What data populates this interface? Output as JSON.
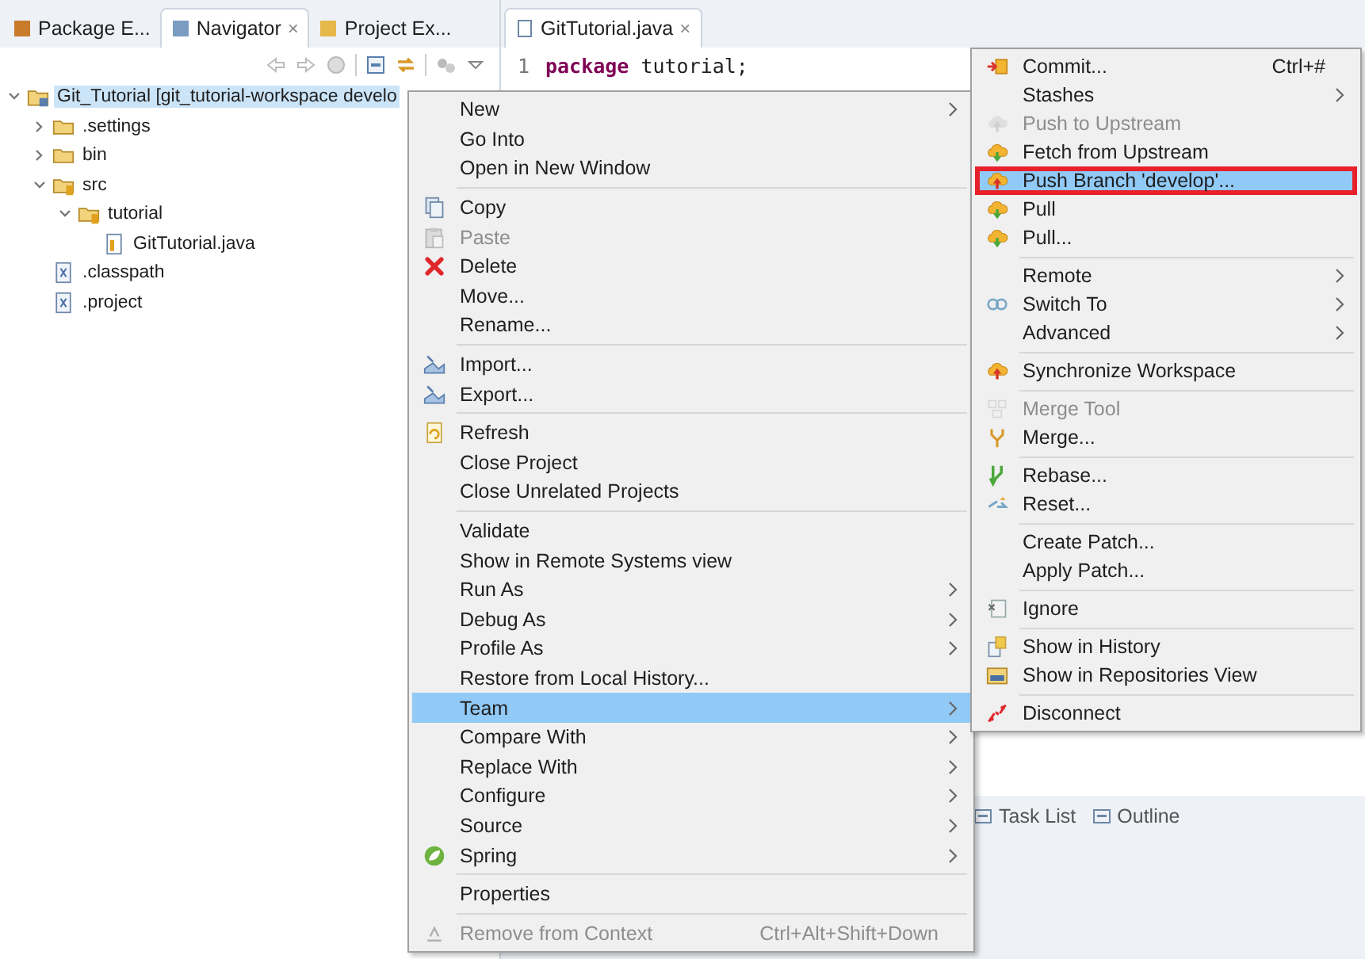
{
  "left_panel": {
    "tabs": [
      {
        "label": "Package E...",
        "selected": false
      },
      {
        "label": "Navigator",
        "selected": true,
        "close": "×"
      },
      {
        "label": "Project Ex...",
        "selected": false
      }
    ],
    "tree": [
      {
        "label": "Git_Tutorial [git_tutorial-workspace develo",
        "kind": "project",
        "selected": true,
        "expanded": true,
        "children": [
          {
            "label": ".settings",
            "kind": "folder",
            "selected": false,
            "expanded": false
          },
          {
            "label": "bin",
            "kind": "folder",
            "selected": false,
            "expanded": false
          },
          {
            "label": "src",
            "kind": "source",
            "selected": false,
            "expanded": true,
            "children": [
              {
                "label": "tutorial",
                "kind": "package",
                "selected": false,
                "expanded": true,
                "children": [
                  {
                    "label": "GitTutorial.java",
                    "kind": "java",
                    "selected": false
                  }
                ]
              }
            ]
          },
          {
            "label": ".classpath",
            "kind": "xml",
            "selected": false
          },
          {
            "label": ".project",
            "kind": "xml",
            "selected": false
          }
        ]
      }
    ]
  },
  "editor": {
    "tabs": [
      {
        "label": "GitTutorial.java",
        "selected": true,
        "close": "×"
      }
    ],
    "lines": [
      {
        "number": "1",
        "tokens": [
          {
            "text": "package",
            "kind": "keyword"
          },
          {
            "text": " tutorial;",
            "kind": "plain"
          }
        ]
      }
    ]
  },
  "bottom_panel": {
    "tabs": [
      {
        "label": "Task List"
      },
      {
        "label": "Outline"
      }
    ]
  },
  "context_menu": [
    {
      "kind": "item",
      "label": "New",
      "submenu": true
    },
    {
      "kind": "item",
      "label": "Go Into"
    },
    {
      "kind": "item",
      "label": "Open in New Window"
    },
    {
      "kind": "separator"
    },
    {
      "kind": "item",
      "label": "Copy"
    },
    {
      "kind": "item",
      "label": "Paste",
      "disabled": true
    },
    {
      "kind": "item",
      "label": "Delete"
    },
    {
      "kind": "item",
      "label": "Move..."
    },
    {
      "kind": "item",
      "label": "Rename..."
    },
    {
      "kind": "separator"
    },
    {
      "kind": "item",
      "label": "Import..."
    },
    {
      "kind": "item",
      "label": "Export..."
    },
    {
      "kind": "separator"
    },
    {
      "kind": "item",
      "label": "Refresh"
    },
    {
      "kind": "item",
      "label": "Close Project"
    },
    {
      "kind": "item",
      "label": "Close Unrelated Projects"
    },
    {
      "kind": "separator"
    },
    {
      "kind": "item",
      "label": "Validate"
    },
    {
      "kind": "item",
      "label": "Show in Remote Systems view"
    },
    {
      "kind": "item",
      "label": "Run As",
      "submenu": true
    },
    {
      "kind": "item",
      "label": "Debug As",
      "submenu": true
    },
    {
      "kind": "item",
      "label": "Profile As",
      "submenu": true
    },
    {
      "kind": "item",
      "label": "Restore from Local History..."
    },
    {
      "kind": "item",
      "label": "Team",
      "submenu": true,
      "selected": true
    },
    {
      "kind": "item",
      "label": "Compare With",
      "submenu": true
    },
    {
      "kind": "item",
      "label": "Replace With",
      "submenu": true
    },
    {
      "kind": "item",
      "label": "Configure",
      "submenu": true
    },
    {
      "kind": "item",
      "label": "Source",
      "submenu": true
    },
    {
      "kind": "item",
      "label": "Spring",
      "submenu": true
    },
    {
      "kind": "separator"
    },
    {
      "kind": "item",
      "label": "Properties"
    },
    {
      "kind": "separator"
    },
    {
      "kind": "item",
      "label": "Remove from Context",
      "disabled": true,
      "shortcut": "Ctrl+Alt+Shift+Down"
    }
  ],
  "team_submenu": [
    {
      "kind": "item",
      "label": "Commit...",
      "shortcut": "Ctrl+#"
    },
    {
      "kind": "item",
      "label": "Stashes",
      "submenu": true
    },
    {
      "kind": "item",
      "label": "Push to Upstream",
      "disabled": true
    },
    {
      "kind": "item",
      "label": "Fetch from Upstream"
    },
    {
      "kind": "item",
      "label": "Push Branch 'develop'...",
      "selected": true,
      "outlined": true
    },
    {
      "kind": "item",
      "label": "Pull"
    },
    {
      "kind": "item",
      "label": "Pull..."
    },
    {
      "kind": "separator"
    },
    {
      "kind": "item",
      "label": "Remote",
      "submenu": true
    },
    {
      "kind": "item",
      "label": "Switch To",
      "submenu": true
    },
    {
      "kind": "item",
      "label": "Advanced",
      "submenu": true
    },
    {
      "kind": "separator"
    },
    {
      "kind": "item",
      "label": "Synchronize Workspace"
    },
    {
      "kind": "separator"
    },
    {
      "kind": "item",
      "label": "Merge Tool",
      "disabled": true
    },
    {
      "kind": "item",
      "label": "Merge..."
    },
    {
      "kind": "separator"
    },
    {
      "kind": "item",
      "label": "Rebase..."
    },
    {
      "kind": "item",
      "label": "Reset..."
    },
    {
      "kind": "separator"
    },
    {
      "kind": "item",
      "label": "Create Patch..."
    },
    {
      "kind": "item",
      "label": "Apply Patch..."
    },
    {
      "kind": "separator"
    },
    {
      "kind": "item",
      "label": "Ignore"
    },
    {
      "kind": "separator"
    },
    {
      "kind": "item",
      "label": "Show in History"
    },
    {
      "kind": "item",
      "label": "Show in Repositories View"
    },
    {
      "kind": "separator"
    },
    {
      "kind": "item",
      "label": "Disconnect"
    }
  ]
}
